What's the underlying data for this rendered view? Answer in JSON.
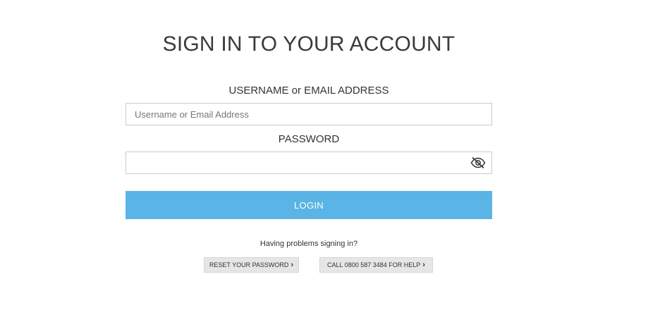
{
  "title": "SIGN IN TO YOUR ACCOUNT",
  "username": {
    "label": "USERNAME or EMAIL ADDRESS",
    "placeholder": "Username or Email Address",
    "value": ""
  },
  "password": {
    "label": "PASSWORD",
    "value": "",
    "toggle_icon": "eye-slash-icon"
  },
  "login": {
    "label": "LOGIN",
    "color": "#5ab4e5"
  },
  "help": {
    "text": "Having problems signing in?",
    "reset_label": "RESET YOUR PASSWORD",
    "call_label": "CALL 0800 587 3484 FOR HELP",
    "chevron": "›"
  }
}
